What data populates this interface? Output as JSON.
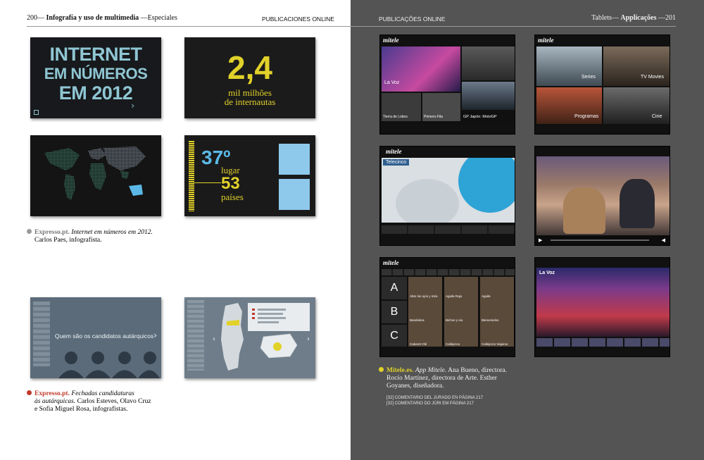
{
  "left_page": {
    "page_number": "200",
    "section": "Infografía y uso de multimedia",
    "subsection": "Especiales",
    "running_head": "PUBLICACIONES ONLINE",
    "thumb1": {
      "line1": "INTERNET",
      "line2": "EM NÚMEROS",
      "line3": "EM 2012"
    },
    "thumb2": {
      "big": "2,4",
      "line1": "mil milhões",
      "line2": "de internautas"
    },
    "thumb4": {
      "rank": "37º",
      "rank_label": "lugar",
      "countries": "53",
      "countries_label": "países"
    },
    "thumb5": {
      "title": "Quem são os candidatos autárquicos"
    },
    "caption1": {
      "outlet": "Expresso.pt.",
      "title": "Internet em números em 2012.",
      "credit": "Carlos Paes, infografista."
    },
    "caption2": {
      "outlet": "Expresso.pt.",
      "title_a": "Fechadas candidaturas",
      "title_b": "às autárquicas.",
      "credit_a": "Carlos Esteves, Olavo Cruz",
      "credit_b": "e Sofia Miguel Rosa, infografistas."
    }
  },
  "right_page": {
    "running_head": "PUBLICAÇÕES ONLINE",
    "category": "Tablets",
    "subcategory": "Applicações",
    "page_number": "201",
    "screen1": {
      "brand": "mitele",
      "hero": "La Voz",
      "tiles": [
        "Tierra de Lobos",
        "Primero Fila",
        "GP Japón: MotoGP"
      ]
    },
    "screen2": {
      "brand": "mitele",
      "labels": [
        "Series",
        "TV Movies",
        "Programas",
        "Cine"
      ]
    },
    "screen3": {
      "brand": "mitele",
      "channel": "Telecinco"
    },
    "screen5": {
      "brand": "mitele",
      "letters": [
        "A",
        "B",
        "C"
      ],
      "titles": [
        "Abre los ojos y mira",
        "Aguila Roja",
        "Aguila",
        "Bandolera",
        "Bichos y cia",
        "Bienvenidos",
        "Cabaret Olé",
        "Callejeros",
        "Callejeros Viajeros"
      ]
    },
    "screen6": {
      "hero": "La Voz"
    },
    "caption": {
      "outlet": "Mitele.es.",
      "title": "App Mitele.",
      "line1": "Ana Bueno, directora.",
      "line2": "Rocío Martínez, directora de Arte. Esther",
      "line3": "Goyanes, diseñadora."
    },
    "notes": [
      "[32] COMENTARIO DEL JURADO EN PÁGINA 217",
      "[32] COMENTARIO DO JÚRI EM PÁGINA 217"
    ]
  },
  "colors": {
    "left_bg": "#ffffff",
    "right_bg": "#545454",
    "accent_grey": "#9a9a9a",
    "accent_red": "#c0392b",
    "accent_yellow": "#e1d12a",
    "infographic_bg": "#1c1c1c",
    "map_cyan": "#5bb8e6"
  },
  "icons": [
    "chevron-right-icon",
    "chevron-left-icon",
    "user-silhouette-icon",
    "play-icon",
    "volume-icon",
    "search-icon"
  ]
}
